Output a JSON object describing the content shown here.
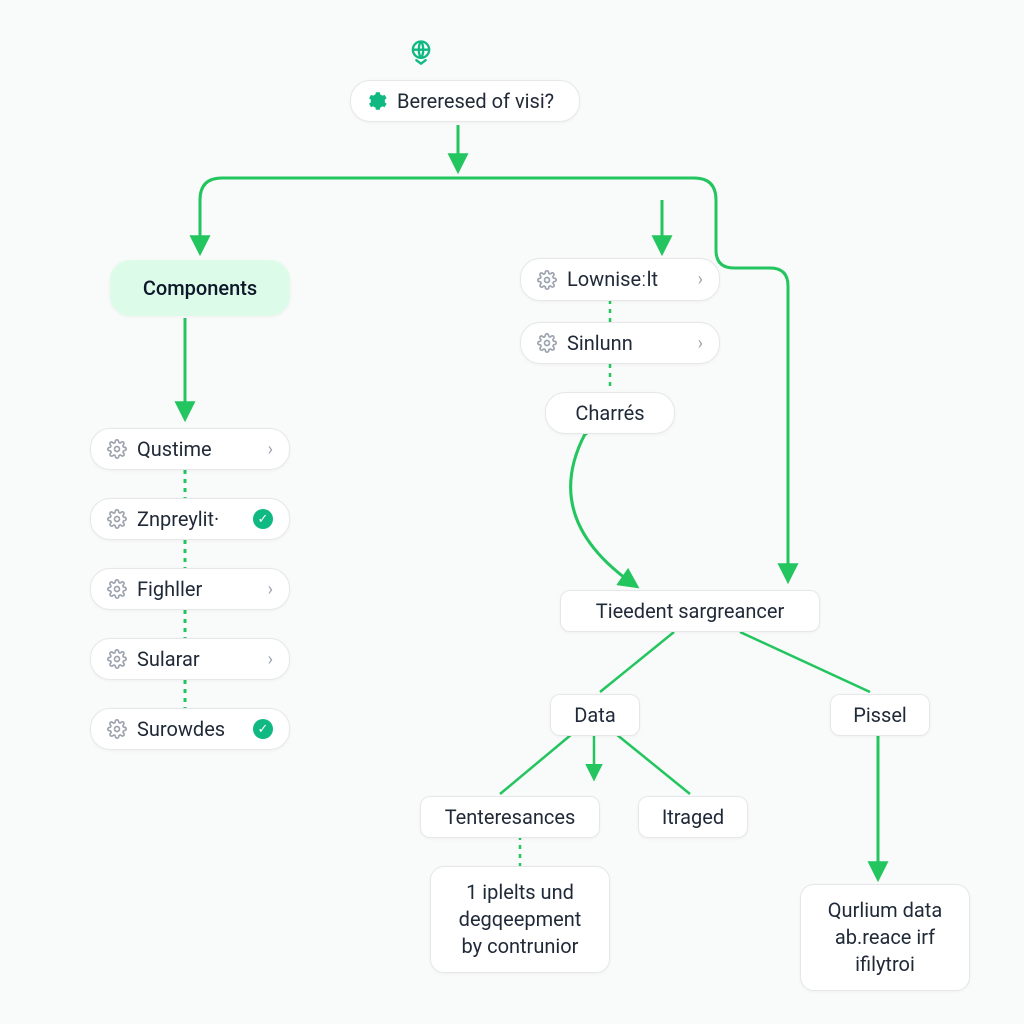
{
  "colors": {
    "accent": "#10b981",
    "edge": "#22c55e",
    "bg": "#f9fafa",
    "node_bg": "#ffffff",
    "node_fill_green": "#dcfbe9",
    "text": "#1f2937",
    "muted": "#9ca3af"
  },
  "root": {
    "icon": "globe-icon",
    "label": "Bereresed of visi?"
  },
  "left_branch": {
    "header": "Components",
    "items": [
      {
        "label": "Qustime",
        "trailing": "chevron"
      },
      {
        "label": "Znpreylit·",
        "trailing": "check"
      },
      {
        "label": "Fighller",
        "trailing": "chevron"
      },
      {
        "label": "Sularar",
        "trailing": "chevron"
      },
      {
        "label": "Surowdes",
        "trailing": "check"
      }
    ]
  },
  "right_branch": {
    "items": [
      {
        "label": "Lowniseːlt",
        "trailing": "chevron"
      },
      {
        "label": "Sinlunn",
        "trailing": "chevron"
      },
      {
        "label": "Charrés",
        "trailing": null
      }
    ],
    "mid_node": "Tieedent sargreancer",
    "children": [
      {
        "label": "Data"
      },
      {
        "label": "Pissel"
      }
    ],
    "data_children": [
      {
        "label": "Tenteresances"
      },
      {
        "label": "Itraged"
      }
    ],
    "data_note": "1 iplelts und degqeepment by contrunior",
    "pissel_note": "Qurlium data ab.reace irf ifilytroi"
  }
}
